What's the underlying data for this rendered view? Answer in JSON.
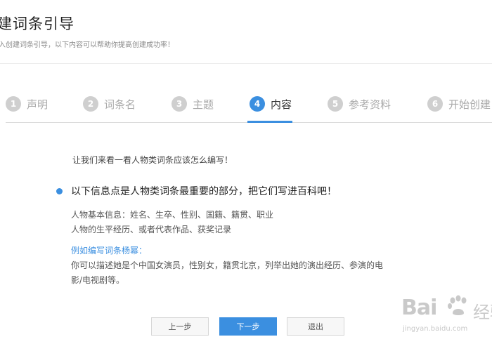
{
  "header": {
    "title": "建词条引导",
    "subtitle": "入创建词条引导，以下内容可以帮助你提高创建成功率！"
  },
  "steps": [
    {
      "number": "1",
      "label": "声明",
      "active": false
    },
    {
      "number": "2",
      "label": "词条名",
      "active": false
    },
    {
      "number": "3",
      "label": "主题",
      "active": false
    },
    {
      "number": "4",
      "label": "内容",
      "active": true
    },
    {
      "number": "5",
      "label": "参考资料",
      "active": false
    },
    {
      "number": "6",
      "label": "开始创建",
      "active": false
    }
  ],
  "content": {
    "intro": "让我们来看一看人物类词条应该怎么编写！",
    "heading": "以下信息点是人物类词条最重要的部分，把它们写进百科吧！",
    "info_lines": [
      "人物基本信息：姓名、生卒、性别、国籍、籍贯、职业",
      "人物的生平经历、或者代表作品、获奖记录"
    ],
    "example_title": "例如编写词条杨幂：",
    "example_lines": [
      "你可以描述她是个中国女演员，性别女，籍贯北京，列举出她的演出经历、参演的电",
      "影/电视剧等。"
    ]
  },
  "buttons": {
    "prev": "上一步",
    "next": "下一步",
    "exit": "退出"
  },
  "watermark": {
    "brand": "Bai",
    "cn": "经验",
    "url": "jingyan.baidu.com"
  },
  "colors": {
    "accent": "#3b8fe0",
    "inactive_step": "#cfcfcf"
  }
}
